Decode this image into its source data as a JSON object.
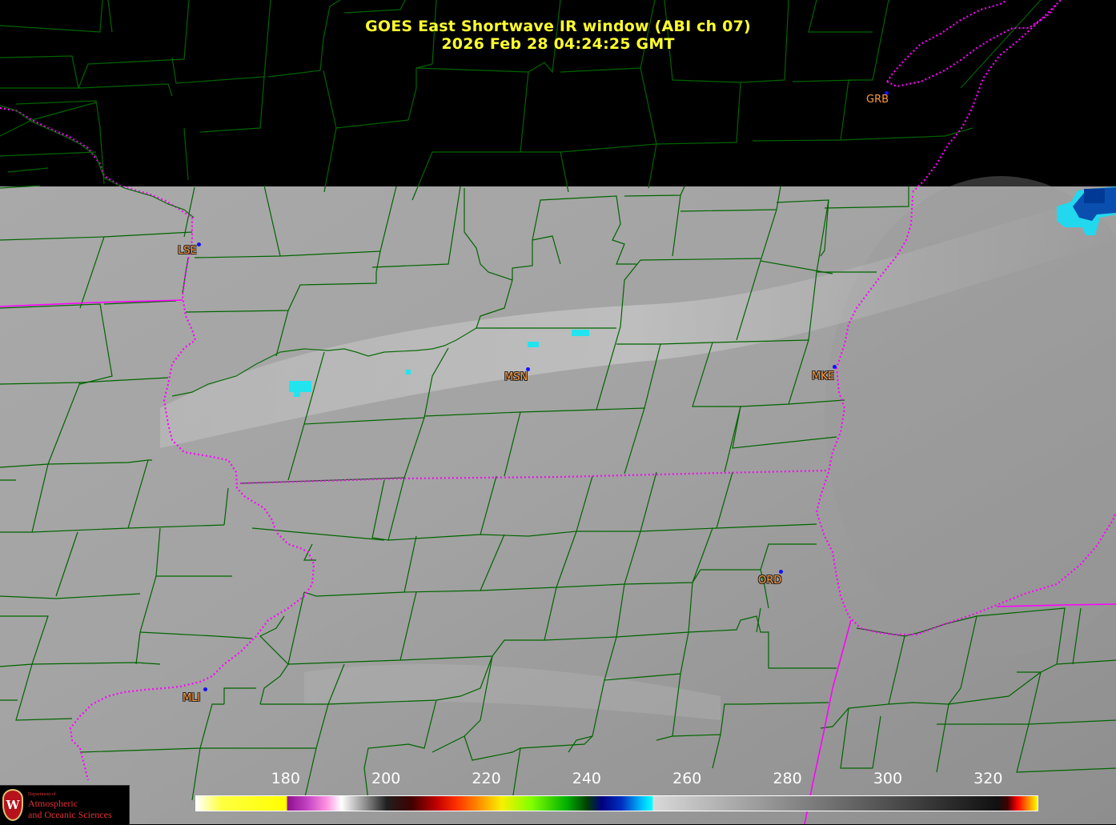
{
  "header": {
    "title": "GOES East Shortwave IR window (ABI ch 07)",
    "datetime": "2026 Feb 28  04:24:25 GMT"
  },
  "stations": [
    {
      "id": "GRB"
    },
    {
      "id": "LSE"
    },
    {
      "id": "MSN"
    },
    {
      "id": "MKE"
    },
    {
      "id": "ORD"
    },
    {
      "id": "MLI"
    }
  ],
  "colorbar": {
    "ticks": [
      "180",
      "200",
      "220",
      "240",
      "260",
      "280",
      "300",
      "320"
    ],
    "range": [
      162,
      330
    ],
    "stops": [
      {
        "value": 162,
        "color": "#ffffff"
      },
      {
        "value": 167,
        "color": "#ffff40"
      },
      {
        "value": 180,
        "color": "#ffff00"
      },
      {
        "value": 180.3,
        "color": "#901090"
      },
      {
        "value": 184,
        "color": "#c040c0"
      },
      {
        "value": 188,
        "color": "#ff90e0"
      },
      {
        "value": 191,
        "color": "#ffffff"
      },
      {
        "value": 196,
        "color": "#888888"
      },
      {
        "value": 200,
        "color": "#202020"
      },
      {
        "value": 205,
        "color": "#400000"
      },
      {
        "value": 210,
        "color": "#c00000"
      },
      {
        "value": 214,
        "color": "#ff3000"
      },
      {
        "value": 219,
        "color": "#ff9900"
      },
      {
        "value": 223,
        "color": "#f8f000"
      },
      {
        "value": 229,
        "color": "#80ff00"
      },
      {
        "value": 236,
        "color": "#00b000"
      },
      {
        "value": 240,
        "color": "#004000"
      },
      {
        "value": 243,
        "color": "#000080"
      },
      {
        "value": 247,
        "color": "#0030c0"
      },
      {
        "value": 251,
        "color": "#00c0ff"
      },
      {
        "value": 253,
        "color": "#00ffff"
      },
      {
        "value": 253.3,
        "color": "#d8d8d8"
      },
      {
        "value": 270,
        "color": "#a8a8a8"
      },
      {
        "value": 300,
        "color": "#505050"
      },
      {
        "value": 322,
        "color": "#101010"
      },
      {
        "value": 324,
        "color": "#400000"
      },
      {
        "value": 326,
        "color": "#ff0000"
      },
      {
        "value": 328,
        "color": "#ff8000"
      },
      {
        "value": 330,
        "color": "#ffff00"
      }
    ]
  },
  "logo": {
    "department": "Department of",
    "line1": "Atmospheric",
    "line2": "and Oceanic Sciences",
    "seal": "W"
  },
  "colors": {
    "county_lines": "#006400",
    "state_lines": "#ff00ff",
    "cloud_cold": "#00ffff",
    "cloud_colder": "#0050c0"
  }
}
